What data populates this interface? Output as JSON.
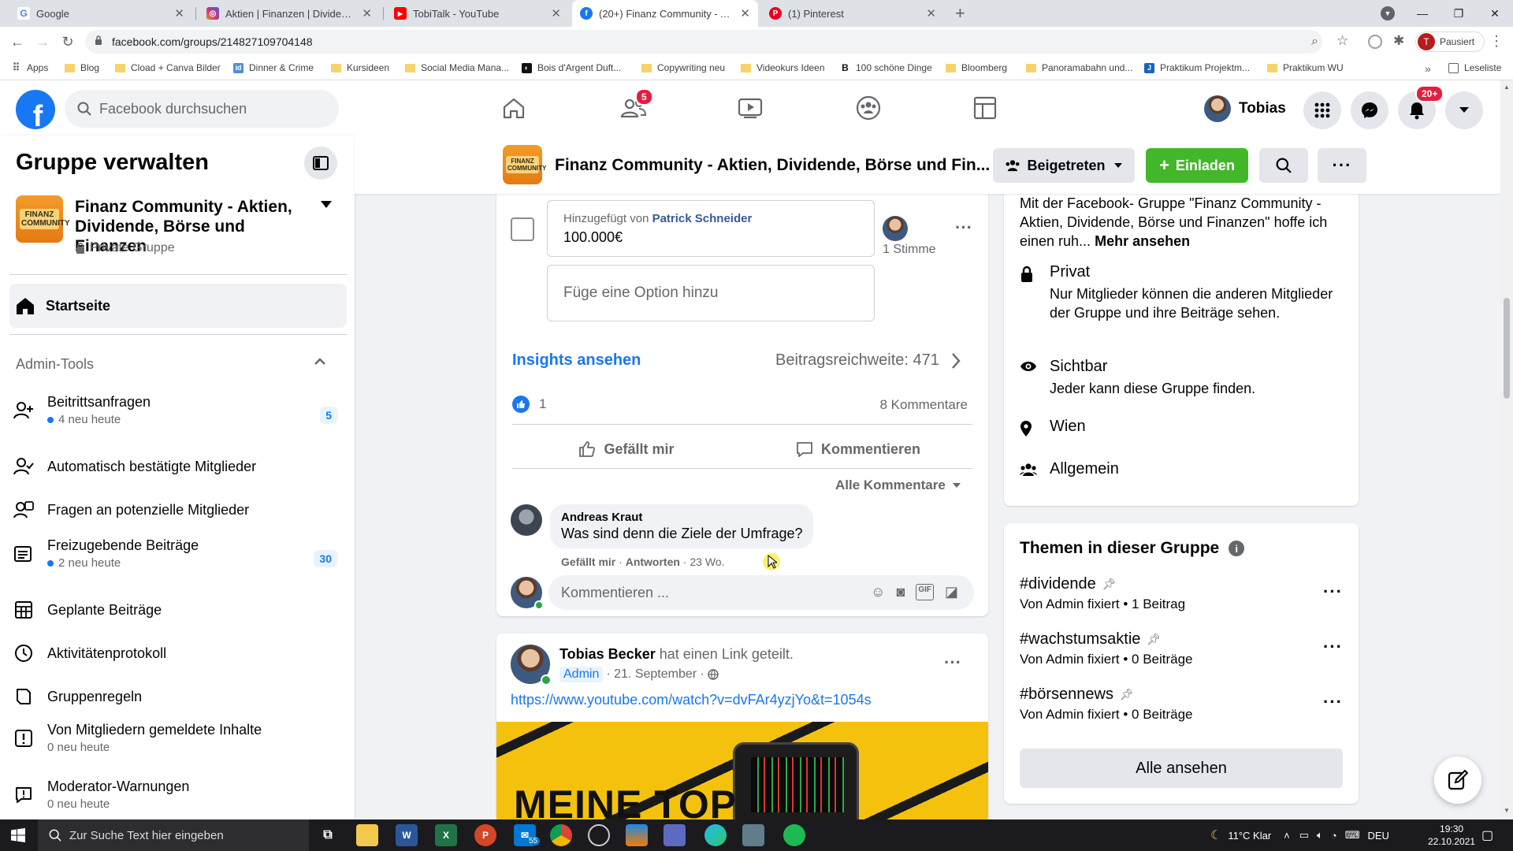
{
  "browser": {
    "tabs": [
      {
        "title": "Google",
        "icon": "google-icon",
        "color": "#4285f4"
      },
      {
        "title": "Aktien | Finanzen | Dividende (@",
        "icon": "instagram-icon",
        "color": "#c13584"
      },
      {
        "title": "TobiTalk - YouTube",
        "icon": "youtube-icon",
        "color": "#ff0000"
      },
      {
        "title": "(20+) Finanz Community - Aktie",
        "icon": "facebook-icon",
        "color": "#1877f2"
      },
      {
        "title": "(1) Pinterest",
        "icon": "pinterest-icon",
        "color": "#e60023"
      }
    ],
    "url": "facebook.com/groups/214827109704148",
    "profile_label": "Pausiert",
    "profile_initial": "T",
    "apps_label": "Apps",
    "reading_list": "Leseliste",
    "bookmarks": [
      "Blog",
      "Cload + Canva Bilder",
      "Dinner & Crime",
      "Kursideen",
      "Social Media Mana...",
      "Bois d'Argent Duft...",
      "Copywriting neu",
      "Videokurs Ideen",
      "100 schöne Dinge",
      "Bloomberg",
      "Panoramabahn und...",
      "Praktikum Projektm...",
      "Praktikum WU"
    ]
  },
  "fb_header": {
    "search_placeholder": "Facebook durchsuchen",
    "friends_badge": "5",
    "notif_badge": "20+",
    "profile_name": "Tobias"
  },
  "sidebar": {
    "title": "Gruppe verwalten",
    "group_name": "Finanz Community - Aktien, Dividende, Börse und Finanzen",
    "group_privacy": "Private Gruppe",
    "logo_text": "FINANZ COMMUNITY",
    "home": "Startseite",
    "admin_tools": "Admin-Tools",
    "items": [
      {
        "label": "Beitrittsanfragen",
        "sub": "4 neu heute",
        "count": "5"
      },
      {
        "label": "Automatisch bestätigte Mitglieder"
      },
      {
        "label": "Fragen an potenzielle Mitglieder"
      },
      {
        "label": "Freizugebende Beiträge",
        "sub": "2 neu heute",
        "count": "30"
      },
      {
        "label": "Geplante Beiträge"
      },
      {
        "label": "Aktivitätenprotokoll"
      },
      {
        "label": "Gruppenregeln"
      },
      {
        "label": "Von Mitgliedern gemeldete Inhalte",
        "sub": "0 neu heute"
      },
      {
        "label": "Moderator-Warnungen",
        "sub": "0 neu heute"
      }
    ]
  },
  "group_header": {
    "title": "Finanz Community - Aktien, Dividende, Börse und Fin...",
    "joined": "Beigetreten",
    "invite": "Einladen"
  },
  "post1": {
    "poll_added_by": "Hinzugefügt von",
    "poll_added_name": "Patrick Schneider",
    "poll_option": "100.000€",
    "poll_votes": "1 Stimme",
    "add_option": "Füge eine Option hinzu",
    "insights": "Insights ansehen",
    "reach": "Beitragsreichweite: 471",
    "likes": "1",
    "comments_count": "8 Kommentare",
    "like_btn": "Gefällt mir",
    "comment_btn": "Kommentieren",
    "all_comments": "Alle Kommentare",
    "comment": {
      "author": "Andreas Kraut",
      "text": "Was sind denn die Ziele der Umfrage?",
      "like": "Gefällt mir",
      "reply": "Antworten",
      "time": "23 Wo."
    },
    "comment_placeholder": "Kommentieren ..."
  },
  "post2": {
    "author": "Tobias Becker",
    "action": "hat einen Link geteilt.",
    "role": "Admin",
    "date": "· 21. September ·",
    "link": "https://www.youtube.com/watch?v=dvFAr4yzjYo&t=1054s",
    "thumb_text": "MEINE TOP"
  },
  "about": {
    "desc": "Mit der Facebook- Gruppe \"Finanz Community - Aktien, Dividende, Börse und Finanzen\" hoffe ich einen ruh...",
    "more": "Mehr ansehen",
    "private_h": "Privat",
    "private_d": "Nur Mitglieder können die anderen Mitglieder der Gruppe und ihre Beiträge sehen.",
    "visible_h": "Sichtbar",
    "visible_d": "Jeder kann diese Gruppe finden.",
    "location": "Wien",
    "category": "Allgemein"
  },
  "topics": {
    "title": "Themen in dieser Gruppe",
    "items": [
      {
        "tag": "#dividende",
        "meta": "Von Admin fixiert • 1 Beitrag"
      },
      {
        "tag": "#wachstumsaktie",
        "meta": "Von Admin fixiert • 0 Beiträge"
      },
      {
        "tag": "#börsennews",
        "meta": "Von Admin fixiert • 0 Beiträge"
      }
    ],
    "see_all": "Alle ansehen"
  },
  "taskbar": {
    "search": "Zur Suche Text hier eingeben",
    "mail_badge": "55",
    "weather": "11°C Klar",
    "lang": "DEU",
    "time": "19:30",
    "date": "22.10.2021"
  },
  "colors": {
    "fb_blue": "#1877f2",
    "green": "#42b72a",
    "badge_red": "#e41e3f"
  }
}
